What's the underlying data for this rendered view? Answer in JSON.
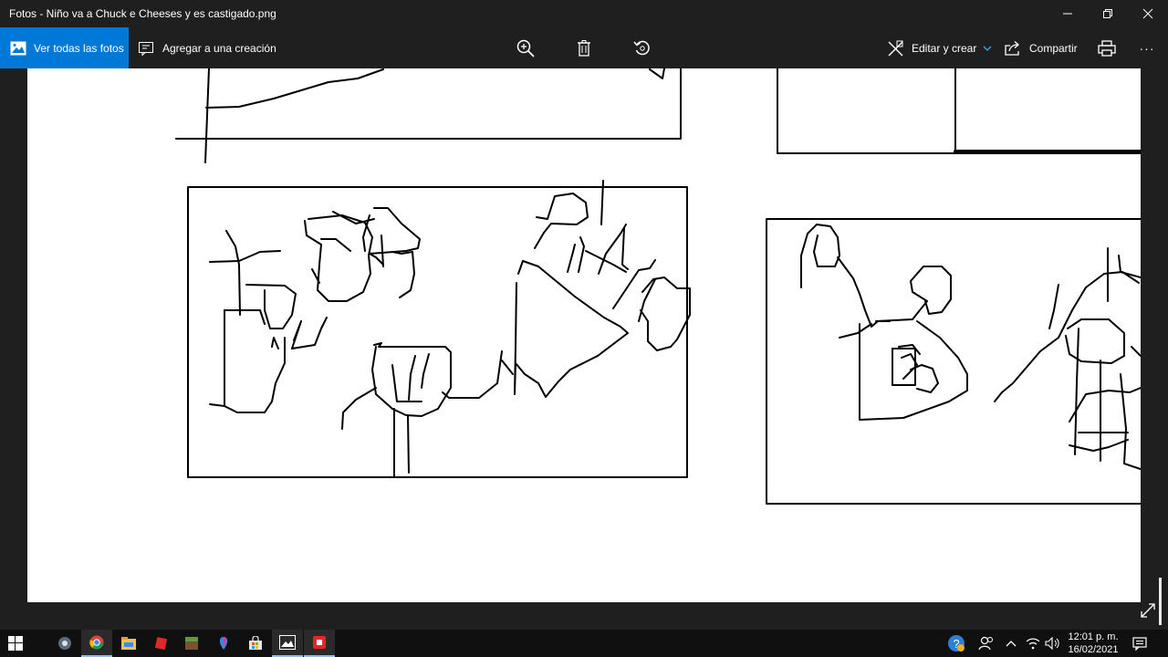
{
  "window": {
    "title": "Fotos - Niño va a Chuck e Cheeses y es castigado.png"
  },
  "toolbar": {
    "all_photos_label": "Ver todas las fotos",
    "add_to_creation_label": "Agregar a una creación",
    "edit_create_label": "Editar y crear",
    "share_label": "Compartir",
    "more_label": "···"
  },
  "taskbar": {
    "time": "12:01 p. m.",
    "date": "16/02/2021"
  },
  "colors": {
    "accent": "#0078d7",
    "chrome": "#1f1f1f",
    "taskbar": "#101010"
  }
}
